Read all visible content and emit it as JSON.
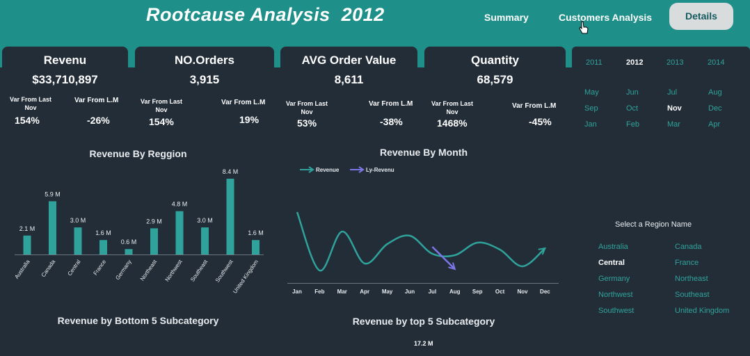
{
  "header": {
    "title": "Rootcause Analysis  2012",
    "nav": [
      "Summary",
      "Customers Analysis",
      "Details"
    ],
    "active_nav": "Details"
  },
  "colors": {
    "band": "#1e9089",
    "panel": "#232d38",
    "accent": "#2fa39b",
    "ly_line": "#7b77e6"
  },
  "kpis": [
    {
      "title": "Revenu",
      "value": "$33,710,897",
      "var_last_label": "Var From Last Nov",
      "var_last_value": "154%",
      "var_lm_label": "Var From L.M",
      "var_lm_value": "-26%"
    },
    {
      "title": "NO.Orders",
      "value": "3,915",
      "var_last_label": "Var From Last Nov",
      "var_last_value": "154%",
      "var_lm_label": "Var From L.M",
      "var_lm_value": "19%"
    },
    {
      "title": "AVG Order Value",
      "value": "8,611",
      "var_last_label": "Var From Last Nov",
      "var_last_value": "53%",
      "var_lm_label": "Var From L.M",
      "var_lm_value": "-38%"
    },
    {
      "title": "Quantity",
      "value": "68,579",
      "var_last_label": "Var From Last Nov",
      "var_last_value": "1468%",
      "var_lm_label": "Var From L.M",
      "var_lm_value": "-45%"
    }
  ],
  "panels": {
    "bottom5_title": "Revenue by Bottom 5 Subcategory",
    "top5_title": "Revenue by top 5 Subcategory",
    "top5_label": "17.2 M"
  },
  "sidebar": {
    "years": [
      "2011",
      "2012",
      "2013",
      "2014"
    ],
    "selected_year": "2012",
    "months": [
      "May",
      "Jun",
      "Jul",
      "Aug",
      "Sep",
      "Oct",
      "Nov",
      "Dec",
      "Jan",
      "Feb",
      "Mar",
      "Apr"
    ],
    "selected_month": "Nov",
    "region_title": "Select a Region Name",
    "regions": [
      "Australia",
      "Canada",
      "Central",
      "France",
      "Germany",
      "Northeast",
      "Northwest",
      "Southeast",
      "Southwest",
      "United Kingdom"
    ],
    "selected_region": "Central"
  },
  "chart_data": [
    {
      "type": "bar",
      "title": "Revenue By Reggion",
      "categories": [
        "Australia",
        "Canada",
        "Central",
        "France",
        "Germany",
        "Northeast",
        "Northwest",
        "Southeast",
        "Southwest",
        "United Kingdom"
      ],
      "values": [
        2.1,
        5.9,
        3.0,
        1.6,
        0.6,
        2.9,
        4.8,
        3.0,
        8.4,
        1.6
      ],
      "labels": [
        "2.1 M",
        "5.9 M",
        "3.0 M",
        "1.6 M",
        "0.6 M",
        "2.9 M",
        "4.8 M",
        "3.0 M",
        "8.4 M",
        "1.6 M"
      ],
      "ylim": [
        0,
        8.4
      ],
      "color": "#2fa39b"
    },
    {
      "type": "line",
      "title": "Revenue By Month",
      "legend": [
        "Revenue",
        "Ly-Revenu"
      ],
      "categories": [
        "Jan",
        "Feb",
        "Mar",
        "Apr",
        "May",
        "Jun",
        "Jul",
        "Aug",
        "Sep",
        "Oct",
        "Nov",
        "Dec"
      ],
      "series": [
        {
          "name": "Revenue",
          "color": "#2fa39b",
          "values": [
            4.6,
            0.4,
            3.2,
            0.9,
            2.3,
            2.9,
            1.6,
            1.5,
            2.4,
            1.9,
            0.7,
            2.0
          ]
        },
        {
          "name": "Ly-Revenu",
          "color": "#7b77e6",
          "values": [
            null,
            null,
            null,
            null,
            null,
            null,
            2.1,
            0.5,
            null,
            null,
            null,
            null
          ]
        }
      ],
      "ylim": [
        0,
        5
      ]
    }
  ]
}
